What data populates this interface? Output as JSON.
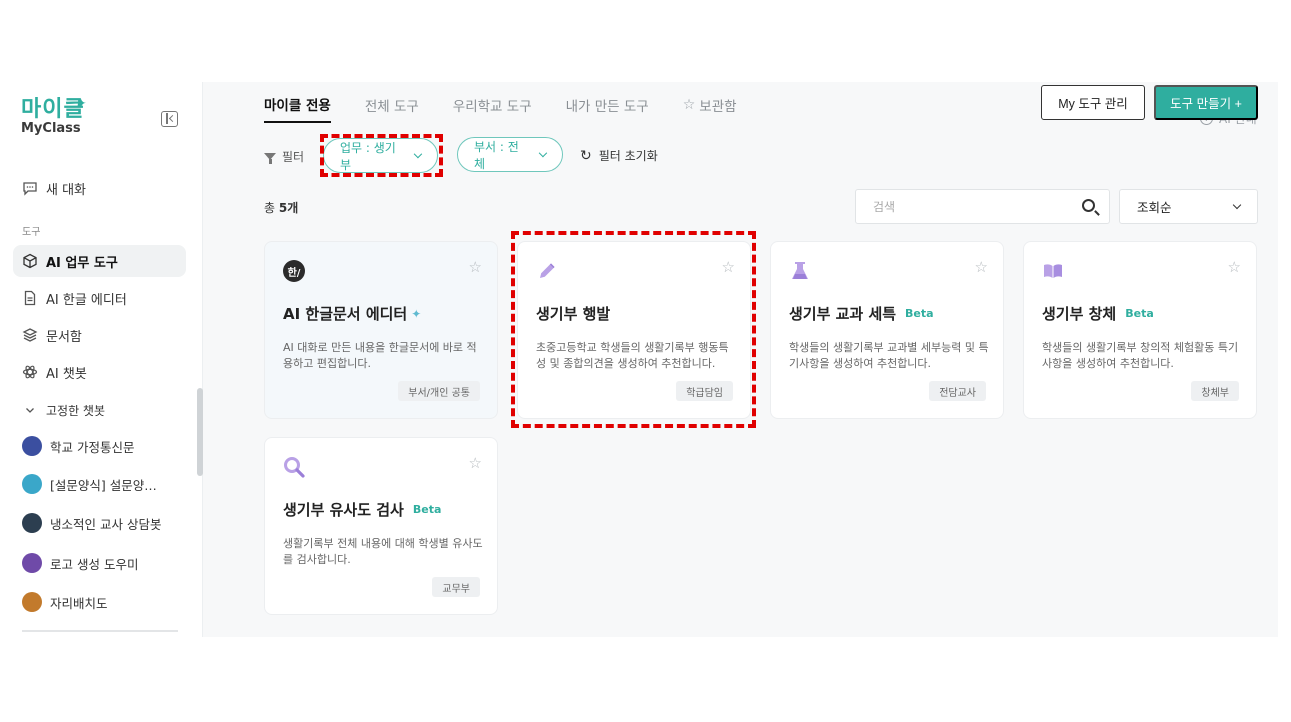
{
  "sidebar": {
    "logo_ko": "마이클",
    "logo_en": "MyClass",
    "new_chat": "새 대화",
    "section_tools": "도구",
    "items": [
      {
        "label": "AI 업무 도구",
        "icon": "cube-icon"
      },
      {
        "label": "AI 한글 에디터",
        "icon": "document-icon"
      },
      {
        "label": "문서함",
        "icon": "layers-icon"
      },
      {
        "label": "AI 챗봇",
        "icon": "atom-icon"
      }
    ],
    "pinned_label": "고정한 챗봇",
    "pinned": [
      {
        "label": "학교 가정통신문",
        "color": "#3b4fa0"
      },
      {
        "label": "[설문양식] 설문양…",
        "color": "#3aa7c9"
      },
      {
        "label": "냉소적인 교사 상담봇",
        "color": "#2c3e50"
      },
      {
        "label": "로고 생성 도우미",
        "color": "#6f4aa8"
      },
      {
        "label": "자리배치도",
        "color": "#c27a2c"
      }
    ]
  },
  "tabs": [
    {
      "label": "마이클 전용",
      "active": true
    },
    {
      "label": "전체 도구",
      "active": false
    },
    {
      "label": "우리학교 도구",
      "active": false
    },
    {
      "label": "내가 만든 도구",
      "active": false
    },
    {
      "label": "보관함",
      "active": false,
      "icon": "star-icon"
    }
  ],
  "header": {
    "my_tools": "My 도구 관리",
    "make_tool": "도구 만들기 +",
    "ai_guide": "AI 안내"
  },
  "filters": {
    "label": "필터",
    "duty": "업무 : 생기부",
    "dept": "부서 : 전체",
    "reset": "필터 초기화"
  },
  "list": {
    "total_prefix": "총 ",
    "total_count": "5개",
    "search_placeholder": "검색",
    "sort": "조회순"
  },
  "cards": [
    {
      "title": "AI 한글문서 에디터",
      "desc": "AI 대화로 만든 내용을 한글문서에 바로 적용하고 편집합니다.",
      "tag": "부서/개인 공통",
      "beta": "",
      "icon": "hangul-icon"
    },
    {
      "title": "생기부 행발",
      "desc": "초중고등학교 학생들의 생활기록부 행동특성 및 종합의견을 생성하여 추천합니다.",
      "tag": "학급담임",
      "beta": "",
      "icon": "pencil-icon"
    },
    {
      "title": "생기부 교과 세특",
      "desc": "학생들의 생활기록부 교과별 세부능력 및 특기사항을 생성하여 추천합니다.",
      "tag": "전담교사",
      "beta": "Beta",
      "icon": "flask-icon"
    },
    {
      "title": "생기부 창체",
      "desc": "학생들의 생활기록부 창의적 체험활동 특기사항을 생성하여 추천합니다.",
      "tag": "창체부",
      "beta": "Beta",
      "icon": "book-icon"
    },
    {
      "title": "생기부 유사도 검사",
      "desc": "생활기록부 전체 내용에 대해 학생별 유사도를 검사합니다.",
      "tag": "교무부",
      "beta": "Beta",
      "icon": "magnifier-icon"
    }
  ],
  "colors": {
    "accent": "#2fae9f",
    "highlight": "#e00000"
  }
}
